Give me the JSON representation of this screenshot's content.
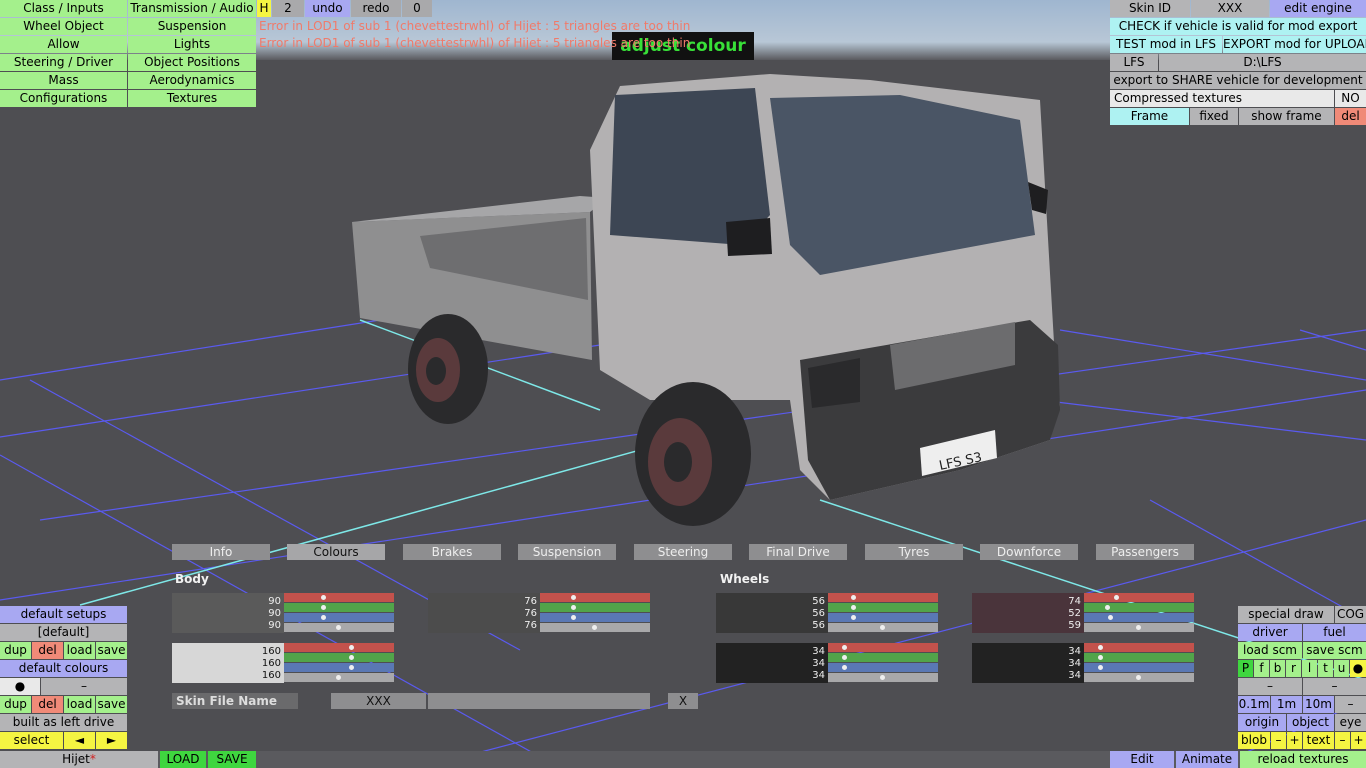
{
  "colors": {
    "menu_green": "#a4f08c",
    "active_green": "#3fd63f",
    "blue": "#a8a8f2",
    "cyan": "#aef2f2",
    "error_red": "#f07a6a",
    "highlight_green": "#38e038"
  },
  "left_menu": [
    [
      "Class / Inputs",
      "Transmission / Audio"
    ],
    [
      "Wheel Object",
      "Suspension"
    ],
    [
      "Allow",
      "Lights"
    ],
    [
      "Steering / Driver",
      "Object Positions"
    ],
    [
      "Mass",
      "Aerodynamics"
    ],
    [
      "Configurations",
      "Textures"
    ]
  ],
  "toolbar": {
    "h": "H",
    "count": "2",
    "undo": "undo",
    "redo": "redo",
    "zero": "0"
  },
  "errors": [
    "Error in LOD1 of sub 1 (chevettestrwhl) of Hijet : 5 triangles are too thin",
    "Error in LOD1 of sub 1 (chevettestrwhl) of Hijet : 5 triangles are too thin"
  ],
  "mode_label": "adjust colour",
  "right_panel": {
    "skin_id": "Skin ID",
    "skin_val": "XXX",
    "edit_engine": "edit engine",
    "check": "CHECK if vehicle is valid for mod export",
    "test": "TEST mod in LFS",
    "export_upload": "EXPORT mod for UPLOAD",
    "lfs": "LFS",
    "path": "D:\\LFS",
    "export_share": "export to SHARE vehicle for development",
    "compressed": "Compressed textures",
    "compressed_val": "NO",
    "frame": "Frame",
    "fixed": "fixed",
    "show_frame": "show frame",
    "del": "del"
  },
  "tabs": [
    "Info",
    "Colours",
    "Brakes",
    "Suspension",
    "Steering",
    "Final Drive",
    "Tyres",
    "Downforce",
    "Passengers"
  ],
  "active_tab": "Colours",
  "sections": {
    "body": "Body",
    "wheels": "Wheels"
  },
  "swatches": [
    {
      "r": 90,
      "g": 90,
      "b": 90,
      "color": "#5a5a5a"
    },
    {
      "r": 76,
      "g": 76,
      "b": 76,
      "color": "#4c4c4c"
    },
    {
      "r": 160,
      "g": 160,
      "b": 160,
      "color": "#d7d7d7"
    },
    {
      "r": 56,
      "g": 56,
      "b": 56,
      "color": "#383838"
    },
    {
      "r": 74,
      "g": 52,
      "b": 59,
      "color": "#4a343b"
    },
    {
      "r": 34,
      "g": 34,
      "b": 34,
      "color": "#222222"
    },
    {
      "r": 34,
      "g": 34,
      "b": 34,
      "color": "#222222"
    }
  ],
  "skin": {
    "label": "Skin File Name",
    "value": "XXX",
    "close": "X"
  },
  "bottom_left": {
    "default_setups": "default setups",
    "default": "[default]",
    "dup": "dup",
    "del": "del",
    "load": "load",
    "save": "save",
    "default_colours": "default colours",
    "dot": "●",
    "dash": "–",
    "built": "built as left drive",
    "select": "select",
    "prev": "◄",
    "next": "►",
    "vehicle": "Hijet",
    "modified": "*",
    "load_btn": "LOAD",
    "save_btn": "SAVE"
  },
  "bottom_right": {
    "special_draw": "special draw",
    "cog": "COG",
    "driver": "driver",
    "fuel": "fuel",
    "load_scm": "load scm",
    "save_scm": "save scm",
    "flags": [
      "P",
      "f",
      "b",
      "r",
      "l",
      "t",
      "u",
      "●"
    ],
    "dash": "–",
    "m01": "0.1m",
    "m1": "1m",
    "m10": "10m",
    "origin": "origin",
    "object": "object",
    "eye": "eye",
    "blob": "blob",
    "plus": "+",
    "text": "text",
    "edit": "Edit",
    "animate": "Animate",
    "reload": "reload textures"
  },
  "plate": "LFS S3"
}
